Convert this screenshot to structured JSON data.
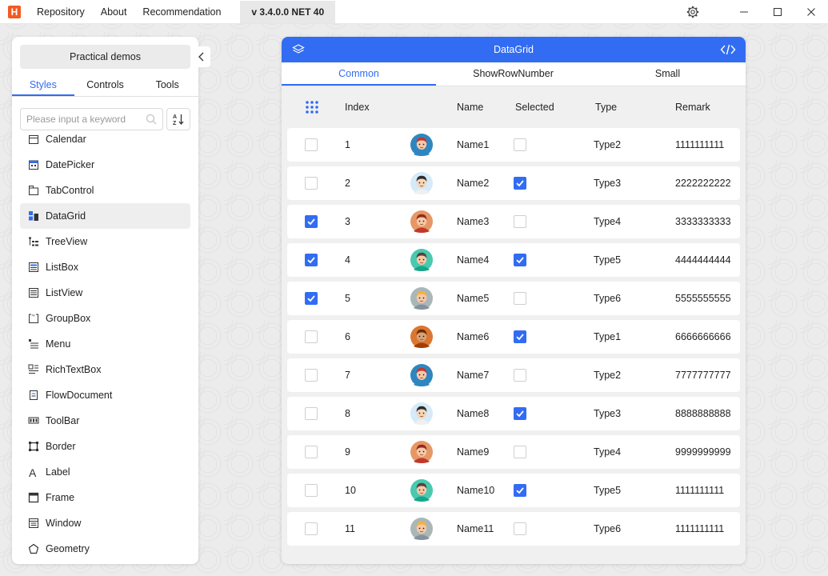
{
  "titlebar": {
    "logo": "H",
    "menu": [
      "Repository",
      "About",
      "Recommendation"
    ],
    "version": "v 3.4.0.0 NET 40",
    "icons": [
      "gear-icon",
      "minimize-icon",
      "maximize-icon",
      "close-icon"
    ]
  },
  "left_panel": {
    "practical_demos": "Practical demos",
    "tabs": [
      {
        "label": "Styles",
        "active": true
      },
      {
        "label": "Controls",
        "active": false
      },
      {
        "label": "Tools",
        "active": false
      }
    ],
    "search_placeholder": "Please input a keyword",
    "items": [
      {
        "label": "Calendar",
        "icon": "calendar-icon"
      },
      {
        "label": "DatePicker",
        "icon": "datepicker-icon"
      },
      {
        "label": "TabControl",
        "icon": "tabcontrol-icon"
      },
      {
        "label": "DataGrid",
        "icon": "datagrid-icon",
        "selected": true
      },
      {
        "label": "TreeView",
        "icon": "treeview-icon"
      },
      {
        "label": "ListBox",
        "icon": "listbox-icon"
      },
      {
        "label": "ListView",
        "icon": "listview-icon"
      },
      {
        "label": "GroupBox",
        "icon": "groupbox-icon"
      },
      {
        "label": "Menu",
        "icon": "menu-icon"
      },
      {
        "label": "RichTextBox",
        "icon": "richtextbox-icon"
      },
      {
        "label": "FlowDocument",
        "icon": "flowdocument-icon"
      },
      {
        "label": "ToolBar",
        "icon": "toolbar-icon"
      },
      {
        "label": "Border",
        "icon": "border-icon"
      },
      {
        "label": "Label",
        "icon": "label-icon"
      },
      {
        "label": "Frame",
        "icon": "frame-icon"
      },
      {
        "label": "Window",
        "icon": "window-icon"
      },
      {
        "label": "Geometry",
        "icon": "geometry-icon"
      }
    ]
  },
  "card": {
    "title": "DataGrid",
    "tabs": [
      {
        "label": "Common",
        "active": true
      },
      {
        "label": "ShowRowNumber",
        "active": false
      },
      {
        "label": "Small",
        "active": false
      }
    ],
    "columns": {
      "index": "Index",
      "name": "Name",
      "selected": "Selected",
      "type": "Type",
      "remark": "Remark"
    },
    "rows": [
      {
        "checked": false,
        "index": "1",
        "avatar": 1,
        "name": "Name1",
        "selected": false,
        "type": "Type2",
        "remark": "1111111111"
      },
      {
        "checked": false,
        "index": "2",
        "avatar": 2,
        "name": "Name2",
        "selected": true,
        "type": "Type3",
        "remark": "2222222222"
      },
      {
        "checked": true,
        "index": "3",
        "avatar": 3,
        "name": "Name3",
        "selected": false,
        "type": "Type4",
        "remark": "3333333333"
      },
      {
        "checked": true,
        "index": "4",
        "avatar": 4,
        "name": "Name4",
        "selected": true,
        "type": "Type5",
        "remark": "4444444444"
      },
      {
        "checked": true,
        "index": "5",
        "avatar": 5,
        "name": "Name5",
        "selected": false,
        "type": "Type6",
        "remark": "5555555555"
      },
      {
        "checked": false,
        "index": "6",
        "avatar": 6,
        "name": "Name6",
        "selected": true,
        "type": "Type1",
        "remark": "6666666666"
      },
      {
        "checked": false,
        "index": "7",
        "avatar": 1,
        "name": "Name7",
        "selected": false,
        "type": "Type2",
        "remark": "7777777777"
      },
      {
        "checked": false,
        "index": "8",
        "avatar": 2,
        "name": "Name8",
        "selected": true,
        "type": "Type3",
        "remark": "8888888888"
      },
      {
        "checked": false,
        "index": "9",
        "avatar": 3,
        "name": "Name9",
        "selected": false,
        "type": "Type4",
        "remark": "9999999999"
      },
      {
        "checked": false,
        "index": "10",
        "avatar": 4,
        "name": "Name10",
        "selected": true,
        "type": "Type5",
        "remark": "1111111111"
      },
      {
        "checked": false,
        "index": "11",
        "avatar": 5,
        "name": "Name11",
        "selected": false,
        "type": "Type6",
        "remark": "1111111111"
      }
    ]
  },
  "colors": {
    "accent": "#326cf3",
    "logo": "#f35a22"
  }
}
